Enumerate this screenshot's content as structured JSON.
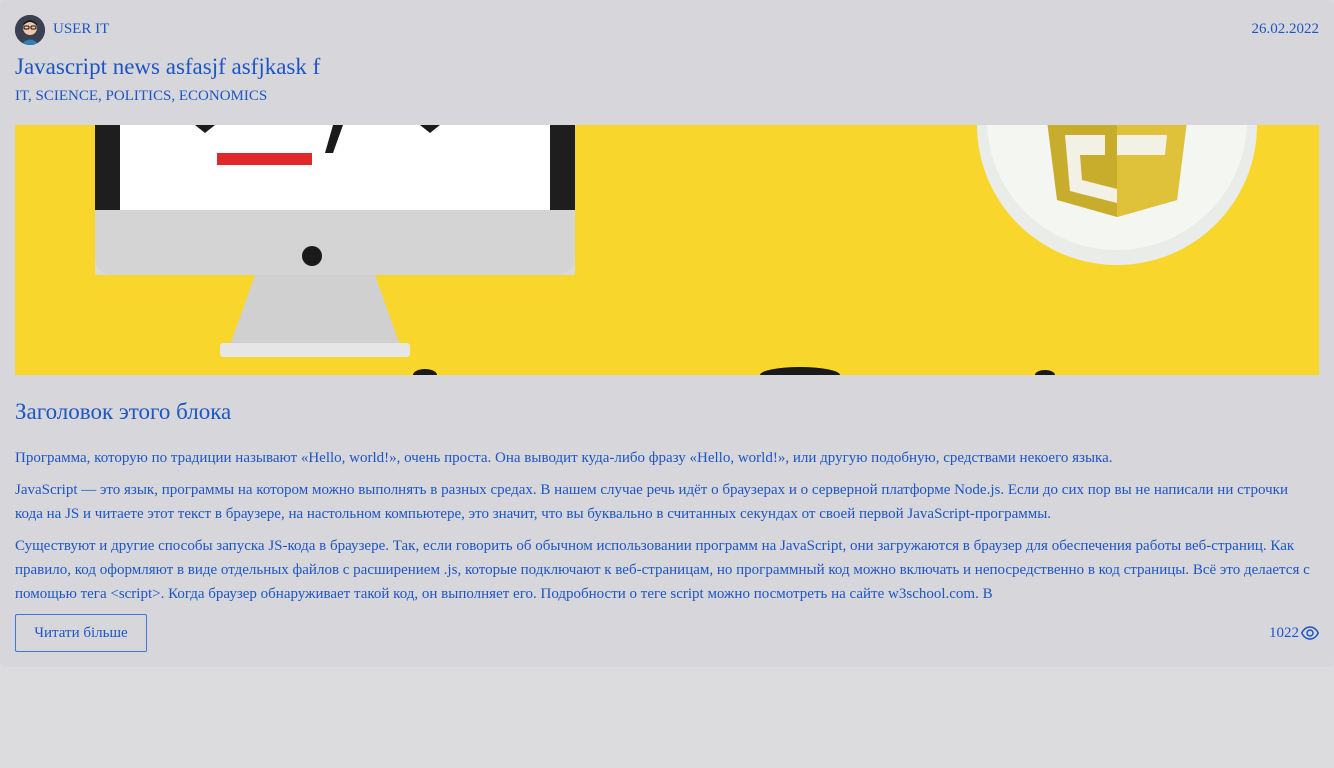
{
  "post": {
    "author": "USER IT",
    "date": "26.02.2022",
    "title": "Javascript news asfasjf asfjkask f",
    "tags": "IT, SCIENCE, POLITICS, ECONOMICS",
    "image_icon": "computer-monitor-javascript-illustration",
    "block_title": "Заголовок этого блока",
    "paragraphs": [
      "Программа, которую по традиции называют «Hello, world!», очень проста. Она выводит куда-либо фразу «Hello, world!», или другую подобную, средствами некоего языка.",
      "JavaScript — это язык, программы на котором можно выполнять в разных средах. В нашем случае речь идёт о браузерах и о серверной платформе Node.js. Если до сих пор вы не написали ни строчки кода на JS и читаете этот текст в браузере, на настольном компьютере, это значит, что вы буквально в считанных секундах от своей первой JavaScript-программы.",
      "Существуют и другие способы запуска JS-кода в браузере. Так, если говорить об обычном использовании программ на JavaScript, они загружаются в браузер для обеспечения работы веб-страниц. Как правило, код оформляют в виде отдельных файлов с расширением .js, которые подключают к веб-страницам, но программный код можно включать и непосредственно в код страницы. Всё это делается с помощью тега <script>. Когда браузер обнаруживает такой код, он выполняет его. Подробности о теге script можно посмотреть на сайте w3school.com. В"
    ],
    "read_more_label": "Читати більше",
    "views": "1022",
    "view_icon": "eye-icon"
  },
  "colors": {
    "background": "#dcdcde",
    "card": "#d7d7db",
    "link": "#1b56c4",
    "hero_yellow": "#f9d62c"
  }
}
